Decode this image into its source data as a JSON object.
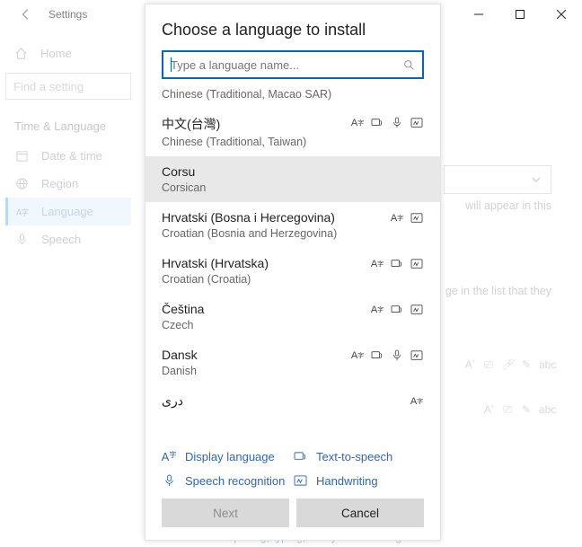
{
  "window": {
    "app_title": "Settings",
    "controls": {
      "min": "−",
      "max": "☐",
      "close": "✕"
    }
  },
  "sidebar": {
    "home": "Home",
    "search_placeholder": "Find a setting",
    "section": "Time & Language",
    "items": [
      {
        "label": "Date & time"
      },
      {
        "label": "Region"
      },
      {
        "label": "Language"
      },
      {
        "label": "Speech"
      }
    ]
  },
  "bg": {
    "text1": "will appear in this",
    "text2": "ge in the list that they",
    "link": "Spelling, typing, & keyboard settings"
  },
  "dialog": {
    "title": "Choose a language to install",
    "search_placeholder": "Type a language name...",
    "partial_top": "Chinese (Traditional, Macao SAR)",
    "langs": [
      {
        "native": "中文(台灣)",
        "eng": "Chinese (Traditional, Taiwan)",
        "feat": [
          "disp",
          "tts",
          "sr",
          "hw"
        ]
      },
      {
        "native": "Corsu",
        "eng": "Corsican",
        "feat": [],
        "hl": true
      },
      {
        "native": "Hrvatski (Bosna i Hercegovina)",
        "eng": "Croatian (Bosnia and Herzegovina)",
        "feat": [
          "disp",
          "hw"
        ]
      },
      {
        "native": "Hrvatski (Hrvatska)",
        "eng": "Croatian (Croatia)",
        "feat": [
          "disp",
          "tts",
          "hw"
        ]
      },
      {
        "native": "Čeština",
        "eng": "Czech",
        "feat": [
          "disp",
          "tts",
          "hw"
        ]
      },
      {
        "native": "Dansk",
        "eng": "Danish",
        "feat": [
          "disp",
          "tts",
          "sr",
          "hw"
        ]
      },
      {
        "native": "درى",
        "eng": "",
        "feat": [
          "disp"
        ]
      }
    ],
    "legend": {
      "disp": "Display language",
      "tts": "Text-to-speech",
      "sr": "Speech recognition",
      "hw": "Handwriting"
    },
    "buttons": {
      "next": "Next",
      "cancel": "Cancel"
    }
  }
}
